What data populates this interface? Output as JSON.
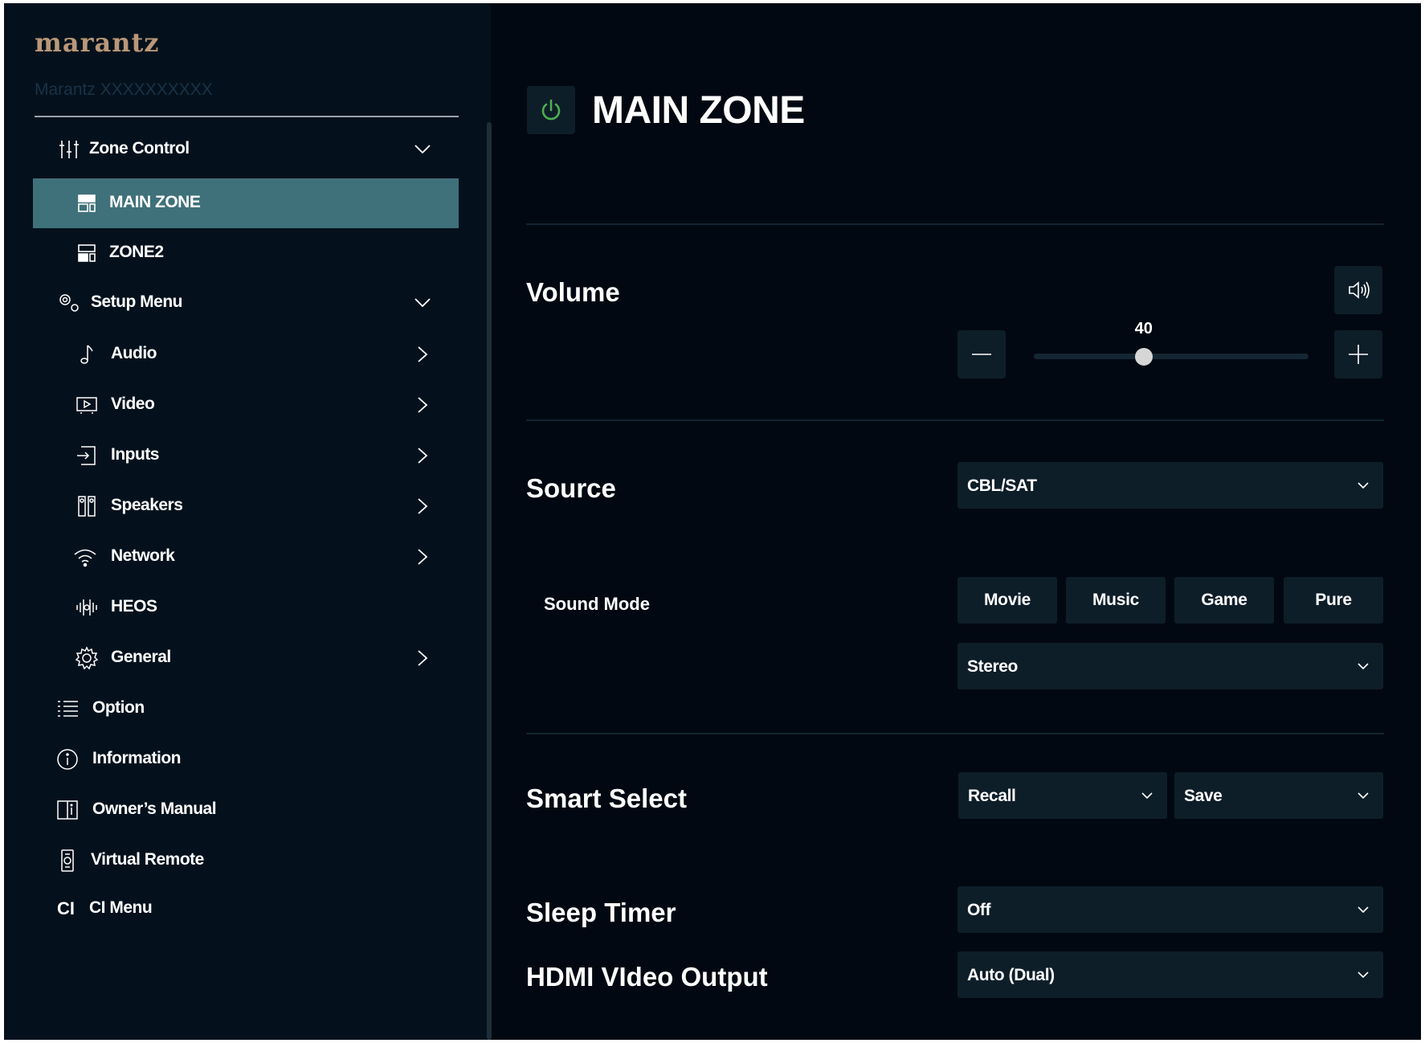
{
  "sidebar": {
    "brand": "marantz",
    "device_name": "Marantz XXXXXXXXXX",
    "zone_control": {
      "label": "Zone Control"
    },
    "zones": [
      {
        "label": "MAIN ZONE",
        "active": true
      },
      {
        "label": "ZONE2",
        "active": false
      }
    ],
    "setup_menu": {
      "label": "Setup Menu"
    },
    "setup_items": [
      {
        "label": "Audio"
      },
      {
        "label": "Video"
      },
      {
        "label": "Inputs"
      },
      {
        "label": "Speakers"
      },
      {
        "label": "Network"
      },
      {
        "label": "HEOS"
      },
      {
        "label": "General"
      }
    ],
    "bottom_items": [
      {
        "label": "Option"
      },
      {
        "label": "Information"
      },
      {
        "label": "Owner’s Manual"
      },
      {
        "label": "Virtual Remote"
      },
      {
        "label": "CI Menu",
        "glyph": "CI"
      }
    ]
  },
  "main": {
    "title": "MAIN ZONE",
    "power_color": "#4caf50",
    "volume": {
      "label": "Volume",
      "value": "40",
      "level": 0.4
    },
    "source": {
      "label": "Source",
      "value": "CBL/SAT"
    },
    "sound_mode": {
      "label": "Sound Mode",
      "buttons": [
        "Movie",
        "Music",
        "Game",
        "Pure"
      ],
      "value": "Stereo"
    },
    "smart_select": {
      "label": "Smart Select",
      "recall": "Recall",
      "save": "Save"
    },
    "sleep_timer": {
      "label": "Sleep Timer",
      "value": "Off"
    },
    "hdmi_output": {
      "label": "HDMI VIdeo Output",
      "value": "Auto (Dual)"
    }
  },
  "colors": {
    "sidebar_bg": "#04111c",
    "main_bg": "#020811",
    "active_item": "#3f717a",
    "control_bg": "#0e1e29",
    "brand": "#b99778"
  }
}
